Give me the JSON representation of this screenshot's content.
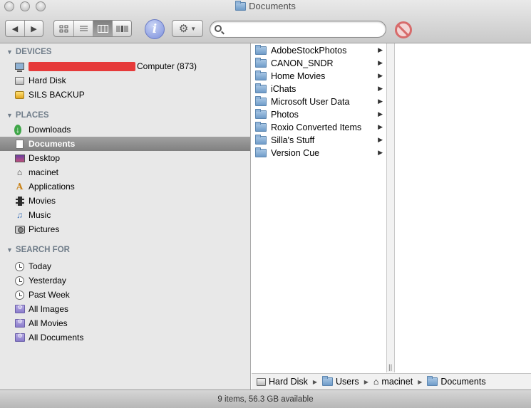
{
  "window": {
    "title": "Documents"
  },
  "toolbar": {
    "back_icon": "back-arrow-icon",
    "forward_icon": "forward-arrow-icon",
    "view_modes": [
      "icon-view",
      "list-view",
      "column-view",
      "coverflow-view"
    ],
    "active_view": "column-view",
    "info_glyph": "i",
    "search": {
      "value": "",
      "placeholder": ""
    }
  },
  "sidebar": {
    "devices": {
      "heading": "DEVICES",
      "items": [
        {
          "label": "Computer (873)",
          "icon": "computer-icon",
          "redacted_prefix": true
        },
        {
          "label": "Hard Disk",
          "icon": "hard-disk-icon"
        },
        {
          "label": "SILS BACKUP",
          "icon": "external-disk-icon"
        }
      ]
    },
    "places": {
      "heading": "PLACES",
      "items": [
        {
          "label": "Downloads",
          "icon": "downloads-icon"
        },
        {
          "label": "Documents",
          "icon": "documents-icon",
          "selected": true
        },
        {
          "label": "Desktop",
          "icon": "desktop-icon"
        },
        {
          "label": "macinet",
          "icon": "home-icon"
        },
        {
          "label": "Applications",
          "icon": "applications-icon"
        },
        {
          "label": "Movies",
          "icon": "movies-icon"
        },
        {
          "label": "Music",
          "icon": "music-icon"
        },
        {
          "label": "Pictures",
          "icon": "pictures-icon"
        }
      ]
    },
    "search_for": {
      "heading": "SEARCH FOR",
      "items": [
        {
          "label": "Today",
          "icon": "clock-icon"
        },
        {
          "label": "Yesterday",
          "icon": "clock-icon"
        },
        {
          "label": "Past Week",
          "icon": "clock-icon"
        },
        {
          "label": "All Images",
          "icon": "smart-folder-icon"
        },
        {
          "label": "All Movies",
          "icon": "smart-folder-icon"
        },
        {
          "label": "All Documents",
          "icon": "smart-folder-icon"
        }
      ]
    }
  },
  "browser": {
    "column1": [
      "AdobeStockPhotos",
      "CANON_SNDR",
      "Home Movies",
      "iChats",
      "Microsoft User Data",
      "Photos",
      "Roxio Converted Items",
      "Silla's Stuff",
      "Version Cue"
    ]
  },
  "pathbar": [
    "Hard Disk",
    "Users",
    "macinet",
    "Documents"
  ],
  "status": {
    "text": "9 items, 56.3 GB available"
  },
  "colors": {
    "selection": "#8d8d8d",
    "section_heading": "#6f7c89",
    "redaction": "#e63a3a"
  }
}
